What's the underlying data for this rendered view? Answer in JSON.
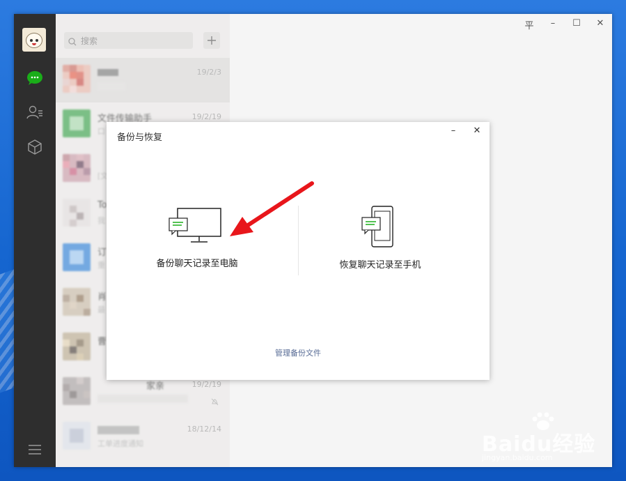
{
  "search": {
    "placeholder": "搜索"
  },
  "chats": [
    {
      "name": "",
      "date": "19/2/3",
      "preview": ""
    },
    {
      "name": "文件传输助手",
      "date": "19/2/19",
      "preview": "口"
    },
    {
      "name": "",
      "date": "",
      "preview": "[文"
    },
    {
      "name": "To",
      "date": "",
      "preview": "我"
    },
    {
      "name": "订",
      "date": "",
      "preview": "重"
    },
    {
      "name": "肖",
      "date": "",
      "preview": "最"
    },
    {
      "name": "曹",
      "date": "",
      "preview": ""
    },
    {
      "name": "家亲",
      "date": "19/2/19",
      "preview": ""
    },
    {
      "name": "",
      "date": "18/12/14",
      "preview": "工单进度通知"
    }
  ],
  "window_controls": {
    "pin": "平",
    "minimize": "–",
    "maximize": "☐",
    "close": "✕"
  },
  "dialog": {
    "title": "备份与恢复",
    "minimize": "–",
    "close": "✕",
    "backup_label": "备份聊天记录至电脑",
    "restore_label": "恢复聊天记录至手机",
    "manage_link": "管理备份文件"
  },
  "watermark": {
    "text": "Baidu经验",
    "sub": "jingyan.baidu.com"
  },
  "colors": {
    "accent_green": "#1aad19",
    "sidebar": "#2e2e2e",
    "link": "#576b95",
    "arrow": "#e8161b"
  }
}
